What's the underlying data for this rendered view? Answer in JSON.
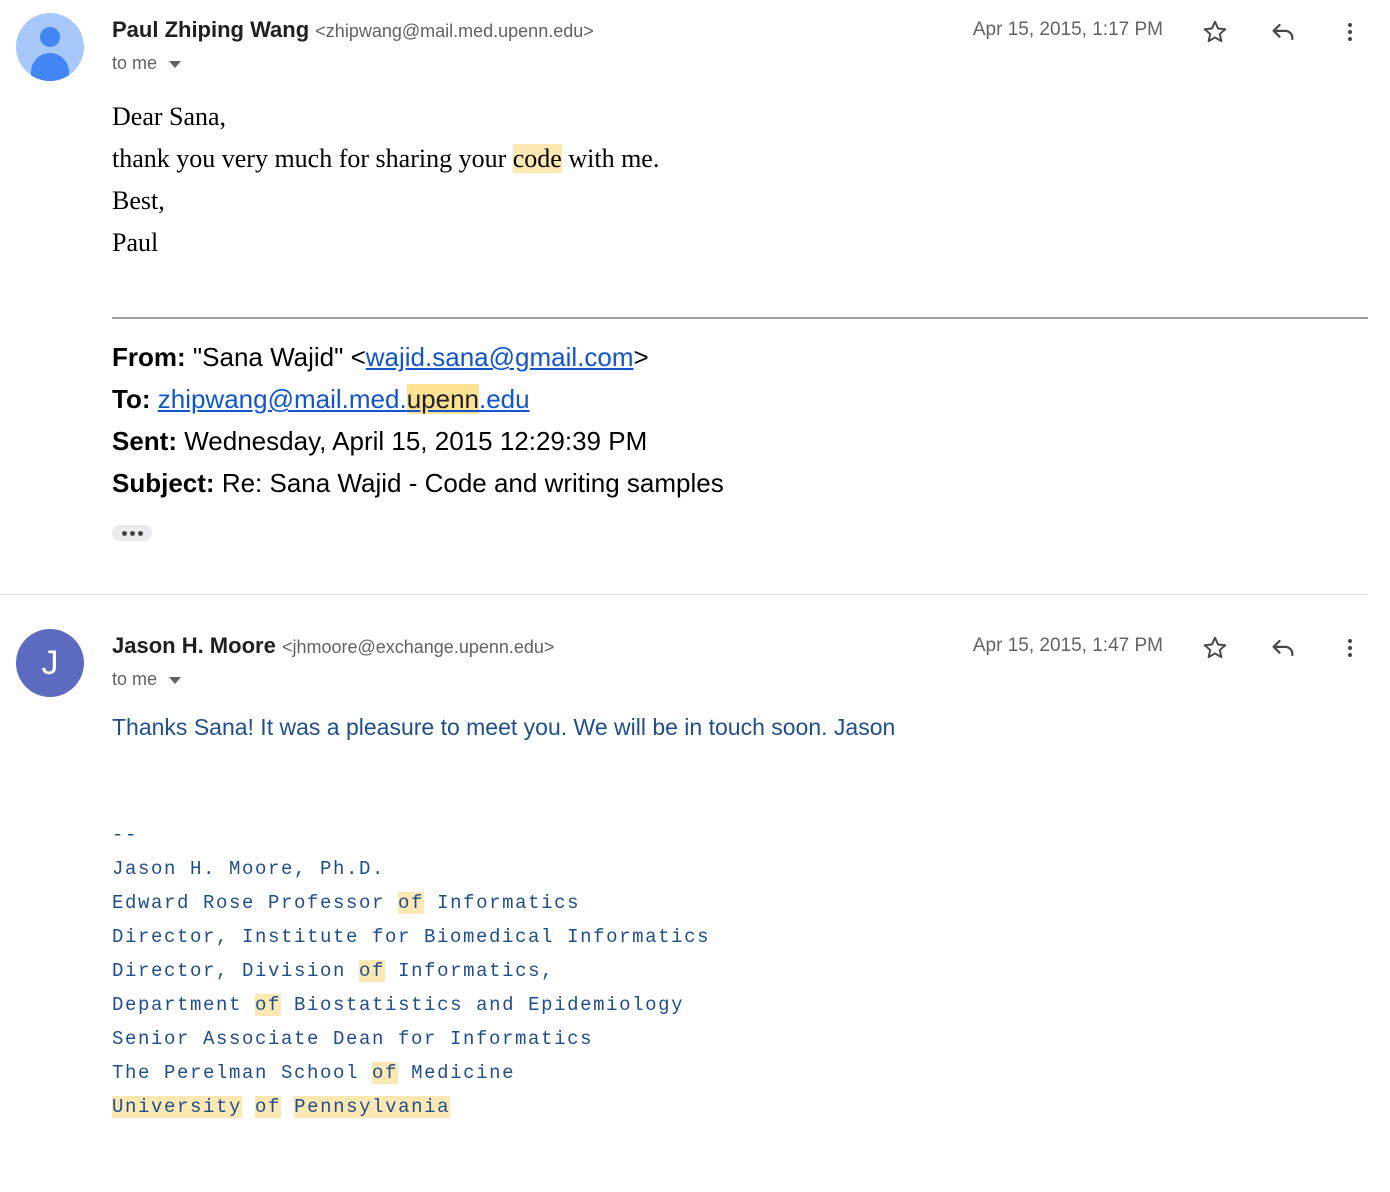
{
  "messages": [
    {
      "sender_name": "Paul Zhiping Wang",
      "sender_email": "<zhipwang@mail.med.upenn.edu>",
      "recipient": "to me",
      "date": "Apr 15, 2015, 1:17 PM",
      "body": {
        "greeting": "Dear Sana,",
        "line_pre": "thank you very much for sharing your ",
        "line_hl": "code",
        "line_post": " with me.",
        "closing": "Best,",
        "name": "Paul"
      },
      "quoted": {
        "from_label": "From:",
        "from_pre": "\"Sana Wajid\" <",
        "from_link": "wajid.sana@gmail.com",
        "from_post": ">",
        "to_label": "To:",
        "to_link_a": "zhipwang@mail.med.",
        "to_link_hl": "upenn",
        "to_link_b": ".edu",
        "sent_label": "Sent:",
        "sent_value": "Wednesday, April 15, 2015 12:29:39 PM",
        "subject_label": "Subject:",
        "subject_value": "Re: Sana Wajid - Code and writing samples"
      }
    },
    {
      "avatar_letter": "J",
      "sender_name": "Jason H. Moore",
      "sender_email": "<jhmoore@exchange.upenn.edu>",
      "recipient": "to me",
      "date": "Apr 15, 2015, 1:47 PM",
      "body": "Thanks Sana! It was a pleasure to meet you. We will be in touch soon. Jason",
      "signature": {
        "dashes": "--",
        "name": "Jason H. Moore, Ph.D.",
        "l2_pre": "Edward Rose Professor ",
        "of": "of",
        "l2_post": " Informatics",
        "l3": "Director, Institute for Biomedical Informatics",
        "l4_pre": "Director, Division ",
        "l4_post": " Informatics,",
        "l5_pre": "Department ",
        "l5_post": " Biostatistics and Epidemiology",
        "l6": "Senior Associate Dean for Informatics",
        "l7_pre": "The Perelman School ",
        "l7_post": " Medicine",
        "l8_a": "University",
        "l8_b": "Pennsylvania"
      }
    }
  ],
  "icons": [
    "star-icon",
    "reply-icon",
    "more-vert-icon",
    "expand-caret-icon",
    "show-trimmed-icon"
  ],
  "colors": {
    "highlight": "#fce8b2",
    "link": "#1155cc",
    "signature": "#1f4e8c",
    "avatar_j": "#5c6bc0"
  }
}
